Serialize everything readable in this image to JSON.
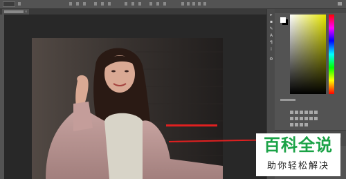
{
  "options_bar": {
    "field_value": "",
    "label": "",
    "icon_names": [
      "move-tool-icon",
      "dropdown-icon",
      "align-icon",
      "distribute-icon",
      "3d-mode-icon"
    ]
  },
  "document_tab": {
    "label": "",
    "close_glyph": "×"
  },
  "canvas": {
    "annotation_text": "",
    "annotation_color": "#e02020"
  },
  "right_panels": {
    "foreground_color": "#ffffff",
    "background_color": "#000000",
    "picker_base_hue": "#e6e600",
    "adjustments_title": ""
  },
  "watermark": {
    "title": "百科全说",
    "subtitle": "助你轻松解决",
    "title_color": "#1aa246"
  },
  "colors": {
    "interface_dark": "#282828",
    "interface_mid": "#535353"
  }
}
